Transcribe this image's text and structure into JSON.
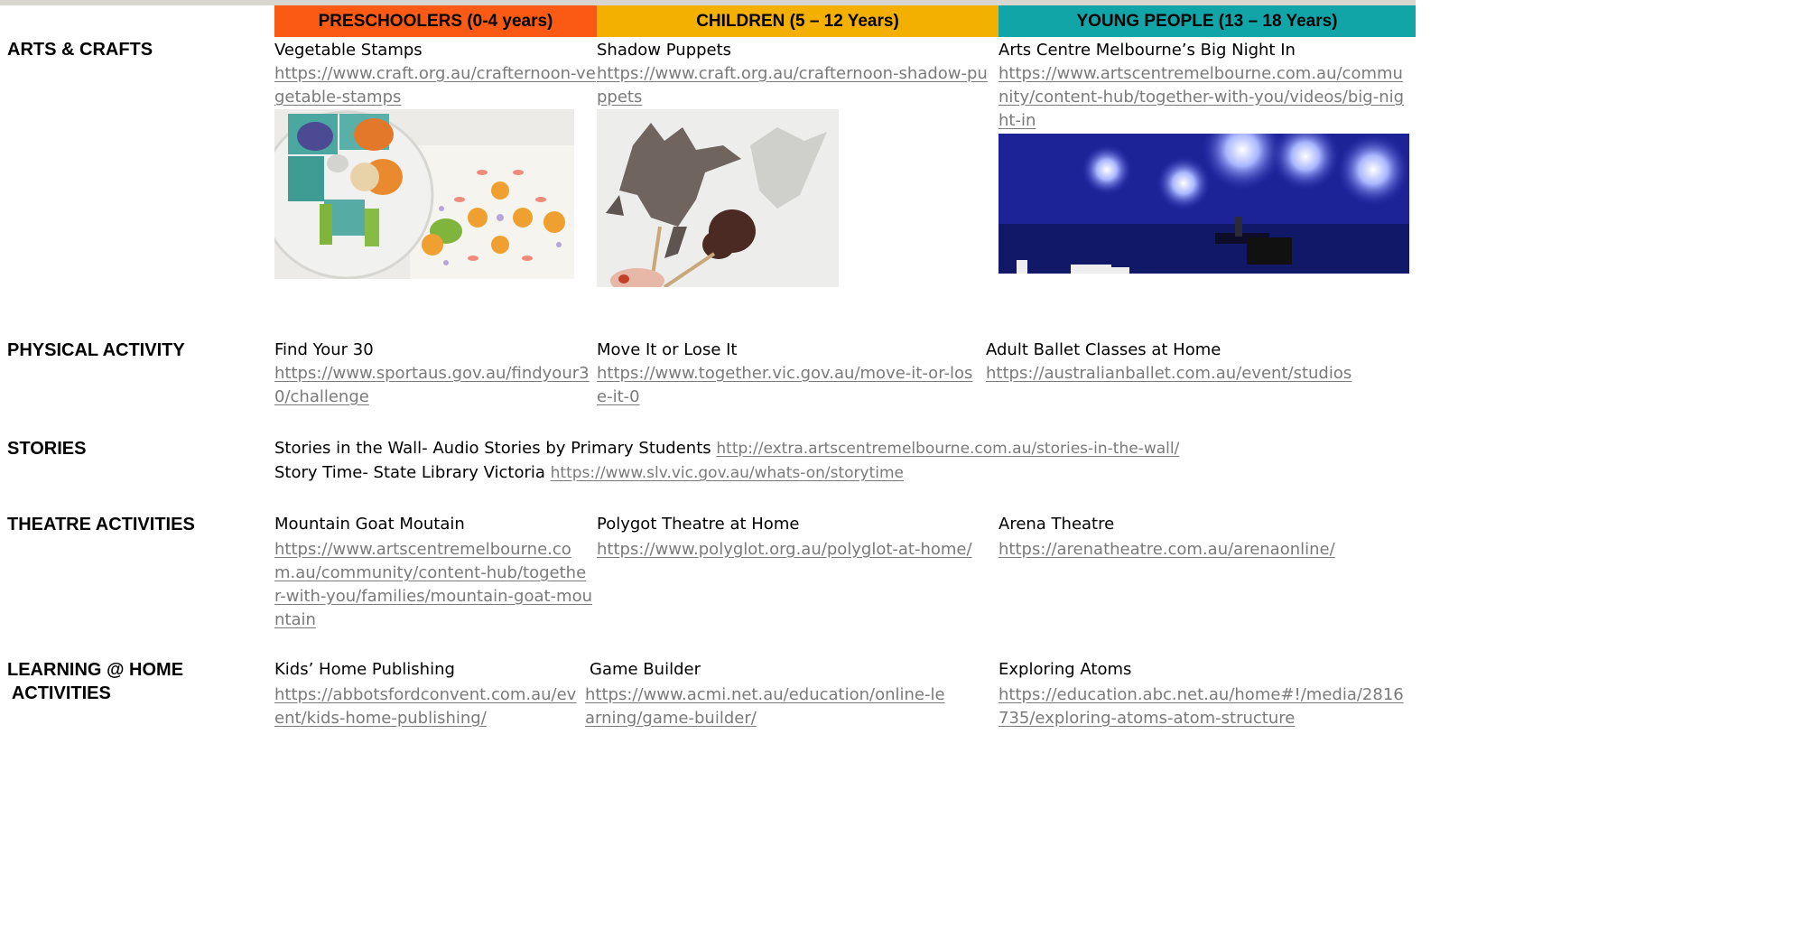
{
  "header": {
    "preschoolers": "PRESCHOOLERS (0-4 years)",
    "children": "CHILDREN (5 – 12 Years)",
    "young_people": "YOUNG PEOPLE (13 – 18 Years)"
  },
  "arts": {
    "category": "ARTS & CRAFTS",
    "pre": {
      "title": "Vegetable Stamps",
      "url": "https://www.craft.org.au/crafternoon-vegetable-stamps"
    },
    "child": {
      "title": "Shadow Puppets",
      "url": "https://www.craft.org.au/crafternoon-shadow-puppets"
    },
    "young": {
      "title": "Arts Centre Melbourne’s Big Night In",
      "url": "https://www.artscentremelbourne.com.au/community/content-hub/together-with-you/videos/big-night-in"
    }
  },
  "physical": {
    "category": "PHYSICAL ACTIVITY",
    "pre": {
      "title": "Find Your 30",
      "url": "https://www.sportaus.gov.au/findyour30/challenge"
    },
    "child": {
      "title": "Move It or Lose It",
      "url": "https://www.together.vic.gov.au/move-it-or-lose-it-0"
    },
    "young": {
      "title": "Adult Ballet Classes at Home",
      "url": "https://australianballet.com.au/event/studios"
    }
  },
  "stories": {
    "category": "STORIES",
    "line1_text": "Stories in the Wall- Audio Stories by Primary Students",
    "line1_url": "http://extra.artscentremelbourne.com.au/stories-in-the-wall/",
    "line2_text": "Story Time- State Library Victoria",
    "line2_url": "https://www.slv.vic.gov.au/whats-on/storytime"
  },
  "theatre": {
    "category": "THEATRE ACTIVITIES",
    "pre": {
      "title": "Mountain Goat Moutain",
      "url": "https://www.artscentremelbourne.com.au/community/content-hub/together-with-you/families/mountain-goat-mountain"
    },
    "child": {
      "title": "Polygot Theatre at Home",
      "url": "https://www.polyglot.org.au/polyglot-at-home/"
    },
    "young": {
      "title": "Arena Theatre",
      "url": "https://arenatheatre.com.au/arenaonline/"
    }
  },
  "learning": {
    "category": "LEARNING @ HOME\n ACTIVITIES",
    "pre": {
      "title": "Kids’ Home Publishing",
      "url": "https://abbotsfordconvent.com.au/event/kids-home-publishing/"
    },
    "child": {
      "title": "Game Builder",
      "url": "https://www.acmi.net.au/education/online-learning/game-builder/"
    },
    "young": {
      "title": "Exploring Atoms",
      "url": "https://education.abc.net.au/home#!/media/2816735/exploring-atoms-atom-structure"
    }
  },
  "colors": {
    "preschool_band": "#fa5a14",
    "children_band": "#f4b000",
    "young_band": "#12a5a8",
    "link": "#7a7a7a"
  }
}
